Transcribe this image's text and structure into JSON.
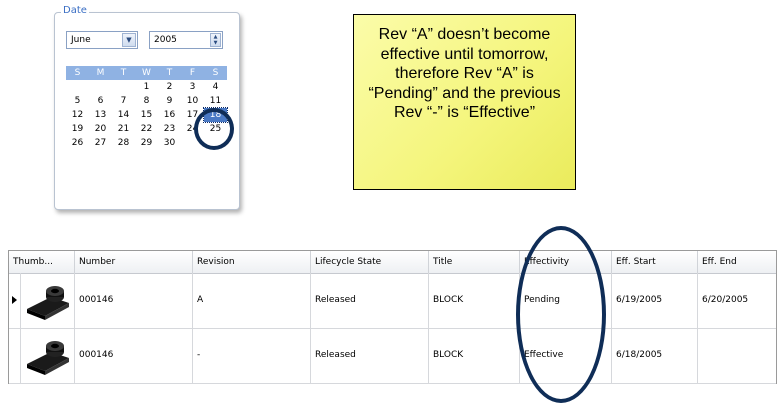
{
  "date_panel": {
    "legend": "Date",
    "month": "June",
    "year": "2005",
    "weekday_headers": [
      "S",
      "M",
      "T",
      "W",
      "T",
      "F",
      "S"
    ],
    "weeks": [
      [
        "",
        "",
        "",
        "1",
        "2",
        "3",
        "4"
      ],
      [
        "5",
        "6",
        "7",
        "8",
        "9",
        "10",
        "11"
      ],
      [
        "12",
        "13",
        "14",
        "15",
        "16",
        "17",
        "18"
      ],
      [
        "19",
        "20",
        "21",
        "22",
        "23",
        "24",
        "25"
      ],
      [
        "26",
        "27",
        "28",
        "29",
        "30",
        "",
        ""
      ]
    ],
    "selected_day": "18"
  },
  "callout": {
    "text": "Rev “A” doesn’t become effective until tomorrow, therefore Rev “A” is “Pending” and the previous Rev “-” is “Effective”"
  },
  "grid": {
    "columns": [
      "Thumb...",
      "Number",
      "Revision",
      "Lifecycle State",
      "Title",
      "Effectivity",
      "Eff. Start",
      "Eff. End"
    ],
    "rows": [
      {
        "number": "000146",
        "revision": "A",
        "lifecycle": "Released",
        "title": "BLOCK",
        "effectivity": "Pending",
        "eff_start": "6/19/2005",
        "eff_end": "6/20/2005"
      },
      {
        "number": "000146",
        "revision": "-",
        "lifecycle": "Released",
        "title": "BLOCK",
        "effectivity": "Effective",
        "eff_start": "6/18/2005",
        "eff_end": ""
      }
    ]
  },
  "colors": {
    "calendar_header": "#8fb2e3",
    "selected_day": "#4a79c4",
    "annotation_circle": "#0f2d57",
    "callout_fill": "#f4f57b"
  },
  "icons": {
    "dropdown": "chevron-down-icon",
    "spinner": "spinner-icon",
    "thumbnail": "part-thumbnail-icon",
    "row_pointer": "row-pointer-icon"
  }
}
